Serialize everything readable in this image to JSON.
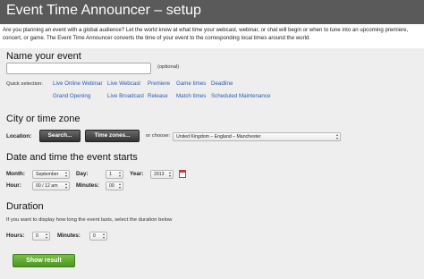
{
  "header": {
    "title": "Event Time Announcer – setup"
  },
  "intro": "Are you planning an event with a global audience? Let the world know at what time your webcast, webinar, or chat will begin or when to tune into an upcoming premiere, concert, or game. The Event Time Announcer converts the time of your event to the corresponding local times around the world.",
  "name_section": {
    "title": "Name your event",
    "optional": "(optional)",
    "event_name_value": "",
    "quick_selection_label": "Quick selection:",
    "quick_links": [
      "Live Online Webinar",
      "Live Webcast",
      "Premiere",
      "Game times",
      "Deadline",
      "Grand Opening",
      "Live Broadcast",
      "Release",
      "Match times",
      "Scheduled Maintenance"
    ]
  },
  "city_section": {
    "title": "City or time zone",
    "location_label": "Location:",
    "search_button": "Search...",
    "timezones_button": "Time zones...",
    "or_choose": "or choose:",
    "selected_location": "United Kingdom – England – Manchester"
  },
  "date_section": {
    "title": "Date and time the event starts",
    "month_label": "Month:",
    "month_value": "September",
    "day_label": "Day:",
    "day_value": "1",
    "year_label": "Year:",
    "year_value": "2013",
    "hour_label": "Hour:",
    "hour_value": "00 / 12 am",
    "minutes_label": "Minutes:",
    "minutes_value": "00"
  },
  "duration_section": {
    "title": "Duration",
    "description": "If you want to display how long the event lasts, select the duration below",
    "hours_label": "Hours:",
    "hours_value": "0",
    "minutes_label": "Minutes:",
    "minutes_value": "0"
  },
  "submit": {
    "label": "Show result"
  },
  "icons": {
    "calendar": "calendar-icon",
    "select_arrows": "updown-arrows-icon"
  },
  "colors": {
    "header_bg": "#5a5a5a",
    "panel_bg": "#eeeeee",
    "link": "#2a5db0",
    "submit_green": "#5aa82e",
    "dark_button": "#444444"
  }
}
